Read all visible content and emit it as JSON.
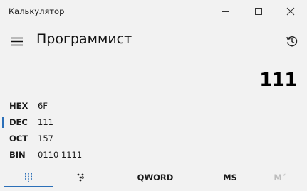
{
  "window": {
    "title": "Калькулятор",
    "controls": {
      "minimize_icon": "minimize-icon",
      "maximize_icon": "maximize-icon",
      "close_icon": "close-icon"
    }
  },
  "header": {
    "menu_icon": "hamburger-icon",
    "mode_title": "Программист",
    "history_icon": "history-icon"
  },
  "display": {
    "value": "111"
  },
  "radix": [
    {
      "name": "HEX",
      "value": "6F",
      "selected": false
    },
    {
      "name": "DEC",
      "value": "111",
      "selected": true
    },
    {
      "name": "OCT",
      "value": "157",
      "selected": false
    },
    {
      "name": "BIN",
      "value": "0110 1111",
      "selected": false
    }
  ],
  "toolbar": {
    "keypad_icon": "full-keypad-icon",
    "bitflip_icon": "bit-toggle-keypad-icon",
    "word_size": "QWORD",
    "memory_store": "MS",
    "memory_recall": "M˅"
  },
  "colors": {
    "background": "#f2f2f2",
    "accent": "#2b6fb8",
    "disabled_text": "#bdbdbd"
  }
}
